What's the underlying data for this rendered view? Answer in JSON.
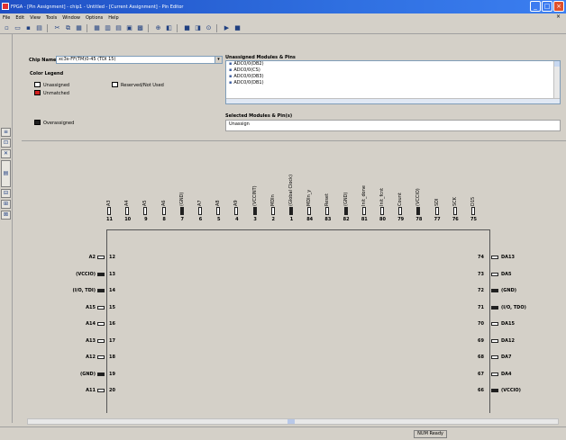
{
  "window": {
    "title": "FPGA - [Pin Assignment] - chip1 - Untitled - [Current Assignment] - Pin Editor",
    "buttons": {
      "min": "_",
      "max": "□",
      "close": "×"
    }
  },
  "menu": [
    "File",
    "Edit",
    "View",
    "Tools",
    "Window",
    "Options",
    "Help"
  ],
  "toolbar_icons": [
    "new-icon",
    "open-icon",
    "save-icon",
    "print-icon",
    "sep",
    "cut-icon",
    "copy-icon",
    "paste-icon",
    "sep",
    "grid-icon",
    "chart-icon",
    "table-icon",
    "pin-icon",
    "chip-icon",
    "sep",
    "zoom-icon",
    "palette-icon",
    "sep",
    "module-icon",
    "layer-icon",
    "search-icon",
    "sep",
    "run-icon",
    "stop-icon"
  ],
  "panel": {
    "chip_label": "Chip Name",
    "chip_value": "xc3s-FF(TM)0-45 (TDI 15)",
    "legend_title": "Color Legend",
    "legend": [
      {
        "label": "Unassigned",
        "color": "#ffffff"
      },
      {
        "label": "Reserved/Not Used",
        "color": "#ffffff"
      },
      {
        "label": "Unmatched",
        "color": "#d02020"
      },
      {
        "label": "Overassigned",
        "color": "#202020"
      }
    ],
    "unassigned_title": "Unassigned Modules & Pins",
    "unassigned_items": [
      "ADC0/0(DB2)",
      "ADC0/0(CS)",
      "ADC0/0(DB3)",
      "ADC0/0(DB1)"
    ],
    "selected_title": "Selected Modules & Pin(s)",
    "selected_value": "Unassign"
  },
  "top_pins": [
    {
      "num": "11",
      "label": "A3",
      "color": "#ffffff"
    },
    {
      "num": "10",
      "label": "A4",
      "color": "#ffffff"
    },
    {
      "num": "9",
      "label": "A5",
      "color": "#ffffff"
    },
    {
      "num": "8",
      "label": "A6",
      "color": "#ffffff"
    },
    {
      "num": "7",
      "label": "(GND)",
      "color": "#202020"
    },
    {
      "num": "6",
      "label": "A7",
      "color": "#ffffff"
    },
    {
      "num": "5",
      "label": "A8",
      "color": "#ffffff"
    },
    {
      "num": "4",
      "label": "A9",
      "color": "#ffffff"
    },
    {
      "num": "3",
      "label": "(VCCINT)",
      "color": "#202020"
    },
    {
      "num": "2",
      "label": "MDIn",
      "color": "#ffffff"
    },
    {
      "num": "1",
      "label": "(Global Clock)",
      "color": "#202020"
    },
    {
      "num": "84",
      "label": "MDIn_y",
      "color": "#ffffff"
    },
    {
      "num": "83",
      "label": "Reset",
      "color": "#ffffff"
    },
    {
      "num": "82",
      "label": "(GND)",
      "color": "#202020"
    },
    {
      "num": "81",
      "label": "Init_done",
      "color": "#ffffff"
    },
    {
      "num": "80",
      "label": "Init_fcnt",
      "color": "#ffffff"
    },
    {
      "num": "79",
      "label": "Count",
      "color": "#ffffff"
    },
    {
      "num": "78",
      "label": "(VCCIO)",
      "color": "#202020"
    },
    {
      "num": "77",
      "label": "SDI",
      "color": "#ffffff"
    },
    {
      "num": "76",
      "label": "SCK",
      "color": "#ffffff"
    },
    {
      "num": "75",
      "label": "D15",
      "color": "#ffffff"
    }
  ],
  "left_pins": [
    {
      "num": "12",
      "label": "A2",
      "color": "#ffffff"
    },
    {
      "num": "13",
      "label": "(VCCIO)",
      "color": "#202020"
    },
    {
      "num": "14",
      "label": "(I/O, TDI)",
      "color": "#202020"
    },
    {
      "num": "15",
      "label": "A15",
      "color": "#ffffff"
    },
    {
      "num": "16",
      "label": "A14",
      "color": "#ffffff"
    },
    {
      "num": "17",
      "label": "A13",
      "color": "#ffffff"
    },
    {
      "num": "18",
      "label": "A12",
      "color": "#ffffff"
    },
    {
      "num": "19",
      "label": "(GND)",
      "color": "#202020"
    },
    {
      "num": "20",
      "label": "A11",
      "color": "#ffffff"
    }
  ],
  "right_pins": [
    {
      "num": "74",
      "label": "DA13",
      "color": "#ffffff"
    },
    {
      "num": "73",
      "label": "DA5",
      "color": "#ffffff"
    },
    {
      "num": "72",
      "label": "(GND)",
      "color": "#202020"
    },
    {
      "num": "71",
      "label": "(I/O, TDO)",
      "color": "#202020"
    },
    {
      "num": "70",
      "label": "DA15",
      "color": "#ffffff"
    },
    {
      "num": "69",
      "label": "DA12",
      "color": "#ffffff"
    },
    {
      "num": "68",
      "label": "DA7",
      "color": "#ffffff"
    },
    {
      "num": "67",
      "label": "DA4",
      "color": "#ffffff"
    },
    {
      "num": "66",
      "label": "(VCCIO)",
      "color": "#202020"
    }
  ],
  "status": {
    "cell": "NUM  Ready"
  }
}
